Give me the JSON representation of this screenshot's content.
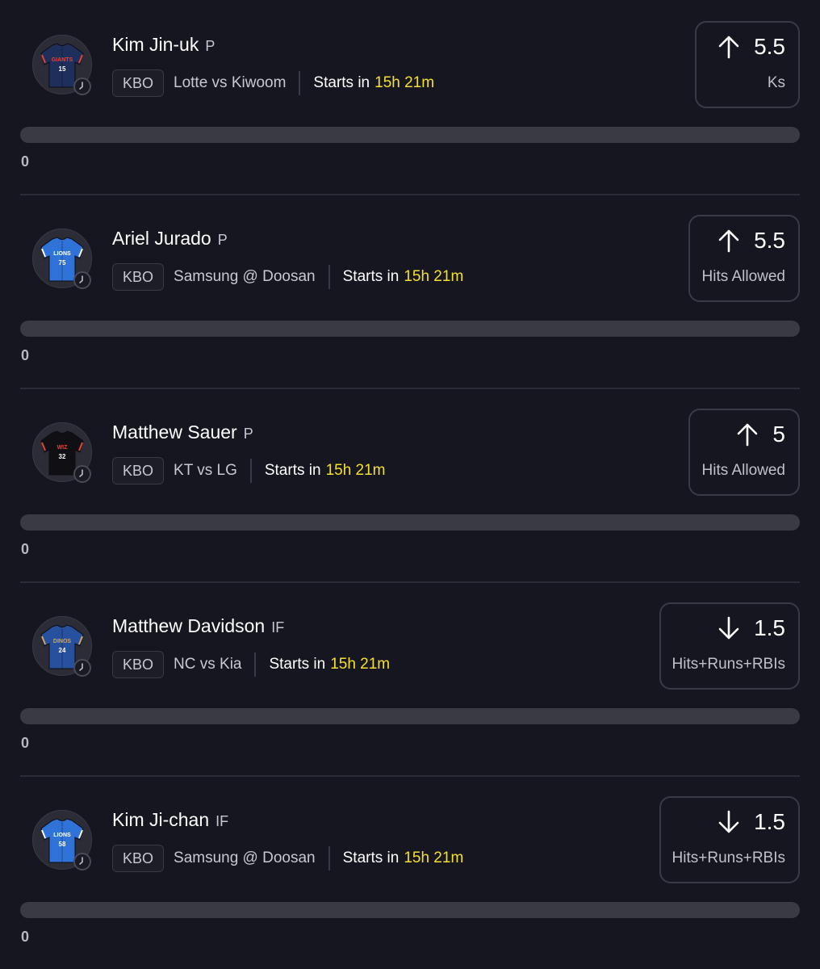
{
  "players": [
    {
      "name": "Kim Jin-uk",
      "position": "P",
      "league": "KBO",
      "matchup": "Lotte vs Kiwoom",
      "starts_label": "Starts in",
      "countdown": "15h 21m",
      "direction": "up",
      "line": "5.5",
      "stat": "Ks",
      "progress_value": "0",
      "jersey": {
        "text": "GIANTS",
        "number": "15",
        "color": "#1f2f5c",
        "trim": "#e0443a"
      }
    },
    {
      "name": "Ariel Jurado",
      "position": "P",
      "league": "KBO",
      "matchup": "Samsung @ Doosan",
      "starts_label": "Starts in",
      "countdown": "15h 21m",
      "direction": "up",
      "line": "5.5",
      "stat": "Hits Allowed",
      "progress_value": "0",
      "jersey": {
        "text": "LIONS",
        "number": "75",
        "color": "#2f72d8",
        "trim": "#ffffff"
      }
    },
    {
      "name": "Matthew Sauer",
      "position": "P",
      "league": "KBO",
      "matchup": "KT vs LG",
      "starts_label": "Starts in",
      "countdown": "15h 21m",
      "direction": "up",
      "line": "5",
      "stat": "Hits Allowed",
      "progress_value": "0",
      "jersey": {
        "text": "WIZ",
        "number": "32",
        "color": "#101014",
        "trim": "#e0443a"
      }
    },
    {
      "name": "Matthew Davidson",
      "position": "IF",
      "league": "KBO",
      "matchup": "NC vs Kia",
      "starts_label": "Starts in",
      "countdown": "15h 21m",
      "direction": "down",
      "line": "1.5",
      "stat": "Hits+Runs+RBIs",
      "progress_value": "0",
      "jersey": {
        "text": "DINOS",
        "number": "24",
        "color": "#27509e",
        "trim": "#c9a86a"
      }
    },
    {
      "name": "Kim Ji-chan",
      "position": "IF",
      "league": "KBO",
      "matchup": "Samsung @ Doosan",
      "starts_label": "Starts in",
      "countdown": "15h 21m",
      "direction": "down",
      "line": "1.5",
      "stat": "Hits+Runs+RBIs",
      "progress_value": "0",
      "jersey": {
        "text": "LIONS",
        "number": "58",
        "color": "#2f72d8",
        "trim": "#ffffff"
      }
    }
  ],
  "colors": {
    "background": "#161620",
    "countdown": "#f5e02a",
    "border": "#3a3a46",
    "progress_track": "#3a3a44"
  },
  "icons": {
    "up": "arrow-up-icon",
    "down": "arrow-down-icon",
    "clock": "clock-icon"
  }
}
